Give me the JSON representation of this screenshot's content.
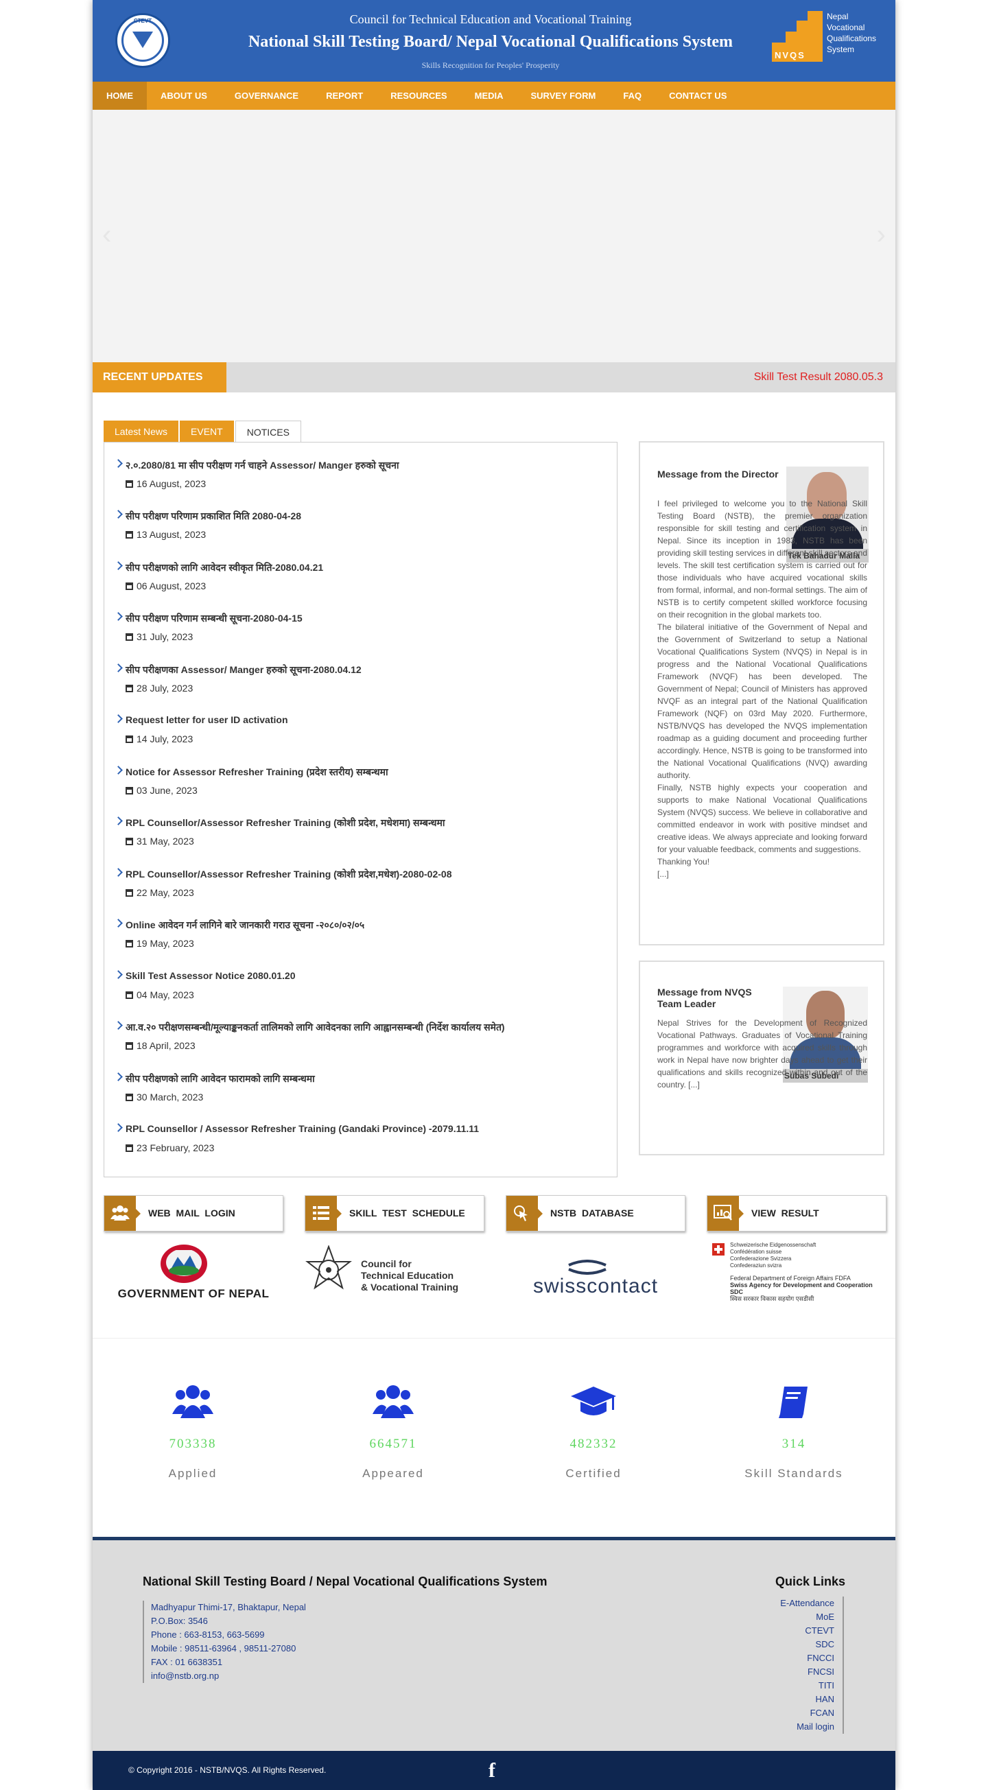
{
  "header": {
    "line1": "Council for Technical Education and Vocational Training",
    "line2": "National Skill Testing Board/ Nepal Vocational Qualifications System",
    "line3": "Skills Recognition for Peoples' Prosperity",
    "left_logo_text": "CTEVT",
    "right_logo_mark": "NVQS",
    "right_logo_lines": [
      "Nepal",
      "Vocational",
      "Qualifications",
      "System"
    ],
    "brand_color": "#2f63b4",
    "accent_color": "#e89a1f"
  },
  "nav": [
    "HOME",
    "ABOUT US",
    "GOVERNANCE",
    "REPORT",
    "RESOURCES",
    "MEDIA",
    "SURVEY FORM",
    "FAQ",
    "CONTACT US"
  ],
  "slider": {
    "prev_icon": "chevron-left-icon",
    "next_icon": "chevron-right-icon"
  },
  "recent": {
    "label": "RECENT UPDATES",
    "ticker": "Skill Test Result 2080.05.3"
  },
  "tabs": [
    "Latest News",
    "EVENT",
    "NOTICES"
  ],
  "news": [
    {
      "title": "२.०.2080/81 मा सीप परीक्षण गर्न चाहने Assessor/ Manger हरुको सूचना",
      "date": "16 August, 2023"
    },
    {
      "title": "सीप परीक्षण परिणाम प्रकाशित मिति 2080-04-28",
      "date": "13 August, 2023"
    },
    {
      "title": "सीप परीक्षणको लागि आवेदन स्वीकृत मिति-2080.04.21",
      "date": "06 August, 2023"
    },
    {
      "title": "सीप परीक्षण परिणाम सम्बन्धी सूचना-2080-04-15",
      "date": "31 July, 2023"
    },
    {
      "title": "सीप परीक्षणका Assessor/ Manger हरुको सूचना-2080.04.12",
      "date": "28 July, 2023"
    },
    {
      "title": "Request letter for user ID activation",
      "date": "14 July, 2023"
    },
    {
      "title": "Notice for Assessor Refresher Training (प्रदेश स्तरीय) सम्बन्धमा",
      "date": "03 June, 2023"
    },
    {
      "title": "RPL Counsellor/Assessor Refresher Training (कोशी प्रदेश, मधेशमा) सम्बन्धमा",
      "date": "31 May, 2023"
    },
    {
      "title": "RPL Counsellor/Assessor Refresher Training (कोशी प्रदेश,मधेश)-2080-02-08",
      "date": "22 May, 2023"
    },
    {
      "title": "Online आवेदन गर्न लागिने बारे जानकारी गराउ सूचना -२०८०/०२/०५",
      "date": "19 May, 2023"
    },
    {
      "title": "Skill Test Assessor Notice 2080.01.20",
      "date": "04 May, 2023"
    },
    {
      "title": "आ.व.२० परीक्षणसम्बन्धी/मूल्याङ्कनकर्ता तालिमको लागि आवेदनका लागि आह्वानसम्बन्धी (निर्देश कार्यालय समेत)",
      "date": "18 April, 2023"
    },
    {
      "title": "सीप परीक्षणको लागि आवेदन फारामको लागि सम्बन्धमा",
      "date": "30 March, 2023"
    },
    {
      "title": "RPL Counsellor / Assessor Refresher Training (Gandaki Province) -2079.11.11",
      "date": "23 February, 2023"
    }
  ],
  "director": {
    "heading": "Message from the Director",
    "name": "Tek Bahadur Malla",
    "p1": "I feel privileged to welcome you to the National Skill Testing Board (NSTB), the premier organization responsible for skill testing and certification system in Nepal. Since its inception in 1983, NSTB has been providing skill testing services in different skill sectors and levels. The skill test certification system is carried out for those individuals who have acquired vocational skills from formal, informal, and non-formal settings. The aim of NSTB is to certify competent skilled workforce focusing on their recognition in the global markets too.",
    "p2": "The bilateral initiative of the Government of Nepal and the Government of Switzerland to setup a National Vocational Qualifications System (NVQS) in Nepal is in progress and the National Vocational Qualifications Framework (NVQF) has been developed. The Government of Nepal; Council of Ministers has approved NVQF as an integral part of the National Qualification Framework (NQF) on 03rd May 2020. Furthermore, NSTB/NVQS has developed the NVQS implementation roadmap as a guiding document and proceeding further accordingly. Hence, NSTB is going to be transformed into the National Vocational Qualifications (NVQ) awarding authority.",
    "p3": "Finally, NSTB highly expects your cooperation and supports to make National Vocational Qualifications System (NVQS) success. We believe in collaborative and committed endeavor in work with positive mindset and creative ideas. We always appreciate and looking forward for your valuable feedback, comments and suggestions.",
    "thanks": "Thanking You!",
    "more": "[...]"
  },
  "leader": {
    "heading": "Message from NVQS Team Leader",
    "name": "Subas Subedi",
    "body": "Nepal Strives for the Development of Recognized Vocational Pathways. Graduates of Vocational Training programmes and workforce with acquired skills through work in Nepal have now brighter days ahead to get their qualifications and skills recognized within and out of the country. [...]"
  },
  "quick_buttons": [
    {
      "label": "WEB MAIL LOGIN",
      "icon": "users-icon"
    },
    {
      "label": "SKILL TEST SCHEDULE",
      "icon": "list-icon"
    },
    {
      "label": "NSTB DATABASE",
      "icon": "pointer-click-icon"
    },
    {
      "label": "VIEW RESULT",
      "icon": "chart-search-icon"
    }
  ],
  "partners": {
    "gov": "GOVERNMENT OF NEPAL",
    "ctevt": [
      "Council for",
      "Technical Education",
      "& Vocational Training"
    ],
    "swiss": "swisscontact",
    "sdc": [
      "Schweizerische Eidgenossenschaft",
      "Confédération suisse",
      "Confederazione Svizzera",
      "Confederaziun svizra",
      "Federal Department of Foreign Affairs FDFA",
      "Swiss Agency for Development and Cooperation SDC",
      "स्विस सरकार विकास सहयोग एसडीसी"
    ]
  },
  "stats": [
    {
      "value": "703338",
      "label": "Applied",
      "icon": "users-icon"
    },
    {
      "value": "664571",
      "label": "Appeared",
      "icon": "users-icon"
    },
    {
      "value": "482332",
      "label": "Certified",
      "icon": "graduation-cap-icon"
    },
    {
      "value": "314",
      "label": "Skill Standards",
      "icon": "book-icon"
    }
  ],
  "footer": {
    "title": "National Skill Testing Board / Nepal Vocational Qualifications System",
    "address": [
      "Madhyapur Thimi-17, Bhaktapur, Nepal",
      "P.O.Box: 3546",
      "Phone : 663-8153, 663-5699",
      "Mobile : 98511-63964 , 98511-27080",
      "FAX : 01 6638351",
      "info@nstb.org.np"
    ],
    "quick_title": "Quick Links",
    "quick_links": [
      "E-Attendance",
      "MoE",
      "CTEVT",
      "SDC",
      "FNCCI",
      "FNCSI",
      "TITI",
      "HAN",
      "FCAN",
      "Mail login"
    ],
    "copyright": "© Copyright 2016 - NSTB/NVQS. All Rights Reserved.",
    "social": "f"
  }
}
